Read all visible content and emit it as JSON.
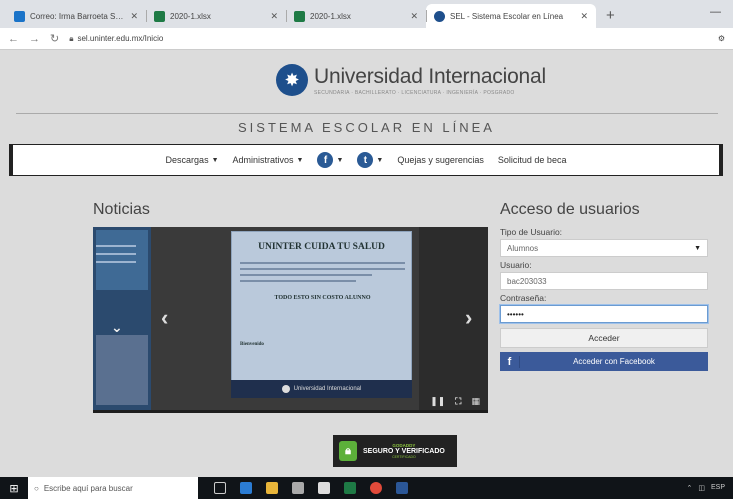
{
  "browser": {
    "tabs": [
      {
        "title": "Correo: Irma Barroeta Sanchez",
        "favicon_color": "#1a73c8",
        "active": false
      },
      {
        "title": "2020-1.xlsx",
        "favicon_color": "#1e7a45",
        "active": false
      },
      {
        "title": "2020-1.xlsx",
        "favicon_color": "#1e7a45",
        "active": false
      },
      {
        "title": "SEL - Sistema Escolar en Línea",
        "favicon_color": "#1e4f8c",
        "active": true
      }
    ],
    "new_tab": "+",
    "minimize": "—",
    "url": "sel.uninter.edu.mx/Inicio"
  },
  "header": {
    "university_name": "Universidad Internacional",
    "tagline": "SECUNDARIA · BACHILLERATO · LICENCIATURA · INGENIERÍA · POSGRADO",
    "system_title": "SISTEMA ESCOLAR EN LÍNEA"
  },
  "menu": {
    "descargas": "Descargas",
    "administrativos": "Administrativos",
    "quejas": "Quejas y sugerencias",
    "beca": "Solicitud de beca"
  },
  "noticias": {
    "title": "Noticias",
    "slide_heading": "UNINTER CUIDA TU SALUD",
    "slide_highlight": "TODO ESTO SIN COSTO ALUNNO",
    "slide_footer": "Universidad Internacional",
    "slide_greeting": "Bienvenido"
  },
  "login": {
    "title": "Acceso de usuarios",
    "user_type_label": "Tipo de Usuario:",
    "user_type_value": "Alumnos",
    "user_label": "Usuario:",
    "user_value": "bac203033",
    "password_label": "Contraseña:",
    "password_value": "••••••",
    "submit": "Acceder",
    "facebook": "Acceder con Facebook"
  },
  "seal": {
    "top": "GODADDY",
    "main": "SEGURO Y VERIFICADO",
    "bottom": "CERTIFICADO"
  },
  "taskbar": {
    "search_placeholder": "Escribe aquí para buscar",
    "tray": "ESP"
  }
}
